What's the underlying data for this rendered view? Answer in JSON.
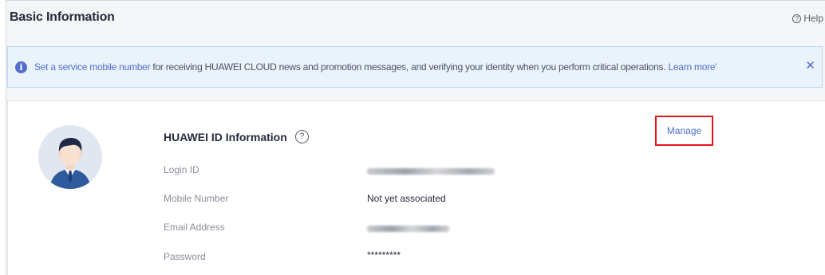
{
  "header": {
    "title": "Basic Information",
    "help_label": "Help",
    "help_icon": "question-circle-icon"
  },
  "notice": {
    "icon": "info-icon",
    "link_text": "Set a service mobile number",
    "body_text": " for receiving HUAWEI CLOUD news and promotion messages, and verifying your identity when you perform critical operations. ",
    "learn_more": "Learn more'",
    "close_symbol": "✕"
  },
  "profile": {
    "section_title": "HUAWEI ID Information",
    "info_icon": "question-circle-icon",
    "manage_label": "Manage",
    "rows": [
      {
        "label": "Login ID",
        "value": "",
        "blurred": true
      },
      {
        "label": "Mobile Number",
        "value": "Not yet associated",
        "blurred": false
      },
      {
        "label": "Email Address",
        "value": "",
        "blurred": true
      },
      {
        "label": "Password",
        "value": "*********",
        "blurred": false
      }
    ]
  },
  "colors": {
    "link": "#526ecc",
    "highlight_border": "#e0161d",
    "notice_bg": "#eaf3fc"
  }
}
